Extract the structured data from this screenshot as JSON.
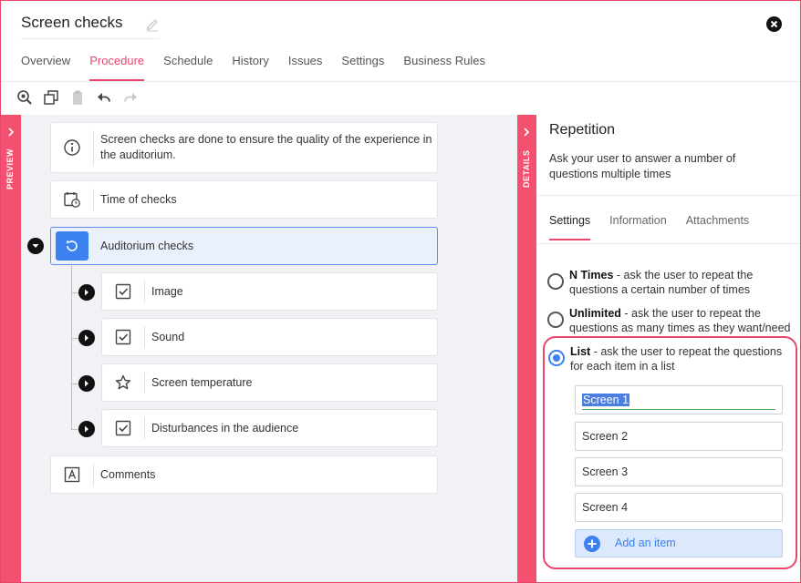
{
  "header": {
    "title": "Screen checks"
  },
  "tabs": [
    {
      "label": "Overview",
      "active": false
    },
    {
      "label": "Procedure",
      "active": true
    },
    {
      "label": "Schedule",
      "active": false
    },
    {
      "label": "History",
      "active": false
    },
    {
      "label": "Issues",
      "active": false
    },
    {
      "label": "Settings",
      "active": false
    },
    {
      "label": "Business Rules",
      "active": false
    }
  ],
  "toolbar": {
    "icons": [
      "zoom-icon",
      "duplicate-icon",
      "paste-icon",
      "undo-icon",
      "redo-icon"
    ]
  },
  "preview_strip": {
    "label": "PREVIEW"
  },
  "details_strip": {
    "label": "DETAILS"
  },
  "procedure": {
    "items": [
      {
        "label": "Screen checks are done to ensure the quality of the experience in the auditorium.",
        "icon": "info-icon"
      },
      {
        "label": "Time of checks",
        "icon": "calendar-clock-icon"
      },
      {
        "label": "Auditorium checks",
        "icon": "repeat-icon",
        "selected": true
      },
      {
        "label": "Image",
        "icon": "checkbox-icon"
      },
      {
        "label": "Sound",
        "icon": "checkbox-icon"
      },
      {
        "label": "Screen temperature",
        "icon": "star-icon"
      },
      {
        "label": "Disturbances in the audience",
        "icon": "checkbox-icon"
      },
      {
        "label": "Comments",
        "icon": "text-box-icon"
      }
    ]
  },
  "details": {
    "title": "Repetition",
    "description": "Ask your user to answer a number of questions multiple times",
    "tabs": [
      {
        "label": "Settings",
        "active": true
      },
      {
        "label": "Information",
        "active": false
      },
      {
        "label": "Attachments",
        "active": false
      }
    ],
    "options": [
      {
        "bold": "N Times",
        "text": " - ask the user to repeat the questions a certain number of times",
        "checked": false
      },
      {
        "bold": "Unlimited",
        "text": " - ask the user to repeat the questions as many times as they want/need",
        "checked": false
      },
      {
        "bold": "List",
        "text": " - ask the user to repeat the questions for each item in a list",
        "checked": true
      }
    ],
    "list_items": [
      "Screen 1",
      "Screen 2",
      "Screen 3",
      "Screen 4"
    ],
    "add_item_label": "Add an item"
  },
  "colors": {
    "accent": "#e8466b",
    "strip": "#f4506f",
    "primary": "#3b82f0"
  }
}
